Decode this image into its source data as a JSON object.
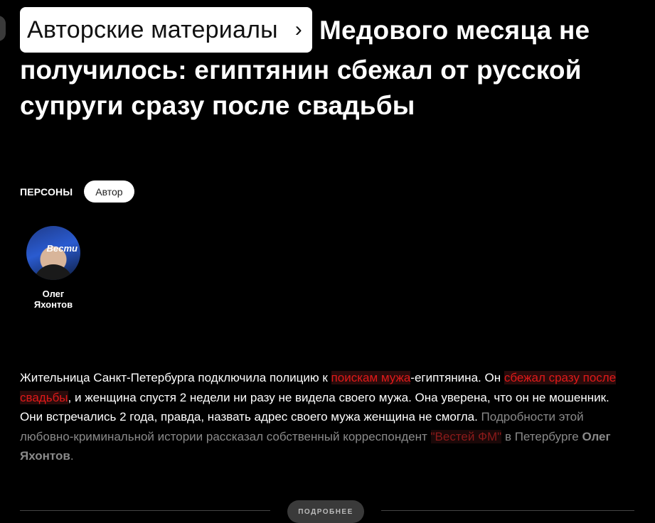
{
  "breadcrumb": {
    "label": "Авторские материалы",
    "chevron": "›"
  },
  "headline": "Медового месяца не получилось: египтянин сбежал от русской супруги сразу после свадьбы",
  "tags": {
    "label": "ПЕРСОНЫ",
    "pill": "Автор"
  },
  "author": {
    "name_first": "Олег",
    "name_last": "Яхонтов",
    "avatar_logo": "Вести"
  },
  "lead": {
    "t1": "Жительница Санкт-Петербурга подключила полицию к ",
    "link1": "поискам мужа",
    "t2": "-египтянина. Он ",
    "link2": "сбежал сразу после свадьбы",
    "t3": ", и женщина спустя 2 недели ни разу не видела своего мужа. Она уверена, что он не мошенник. Они встречались 2 года, правда, назвать адрес своего мужа женщина не смогла. ",
    "t4": "Подробности этой любовно-криминальной истории рассказал собственный корреспондент ",
    "link3": "\"Вестей ФМ\"",
    "t5": " в Петербурге ",
    "t6": "Олег Яхонтов",
    "t7": "."
  },
  "more": {
    "label": "ПОДРОБНЕЕ"
  },
  "colors": {
    "background": "#000000",
    "accent": "#e01919"
  }
}
